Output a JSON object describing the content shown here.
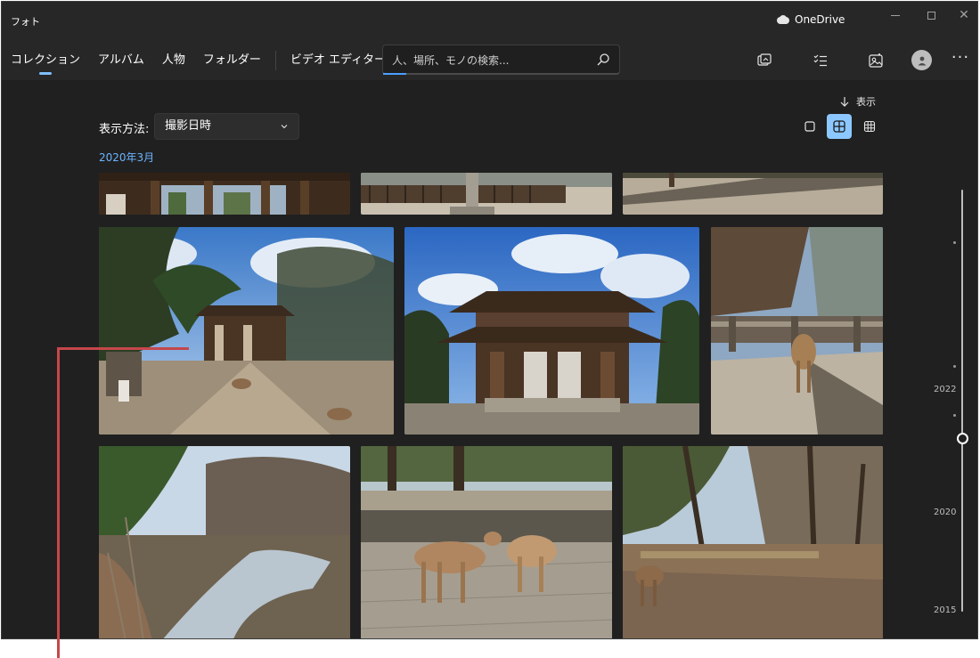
{
  "app": {
    "title": "フォト"
  },
  "onedrive": {
    "label": "OneDrive"
  },
  "nav": {
    "tabs": [
      {
        "label": "コレクション",
        "active": true
      },
      {
        "label": "アルバム"
      },
      {
        "label": "人物"
      },
      {
        "label": "フォルダー"
      },
      {
        "label": "ビデオ エディター"
      }
    ]
  },
  "search": {
    "placeholder": "人、場所、モノの検索..."
  },
  "toolbar": {
    "icons": [
      "import-icon",
      "select-icon",
      "edit-image-icon",
      "account-avatar",
      "more-icon"
    ],
    "sort_label": "表示"
  },
  "view": {
    "label": "表示方法:",
    "selected": "撮影日時",
    "size_options": [
      "large",
      "medium",
      "small"
    ],
    "active_size": "medium"
  },
  "collection": {
    "date_group": "2020年3月",
    "photos": [
      {
        "desc": "temple gate wooden detail"
      },
      {
        "desc": "stone lantern and wooden fence"
      },
      {
        "desc": "gravel path and stones"
      },
      {
        "desc": "temple gate with deer in courtyard"
      },
      {
        "desc": "great wooden temple gate under blue sky"
      },
      {
        "desc": "deer on wooden bridge"
      },
      {
        "desc": "stream through woods"
      },
      {
        "desc": "two deer touching noses"
      },
      {
        "desc": "deer in park with trees"
      }
    ]
  },
  "timeline": {
    "years": [
      "2022",
      "2020",
      "2015"
    ],
    "accent": "#6cb4ff"
  },
  "colors": {
    "window_bg": "#272727",
    "content_bg": "#202020",
    "accent": "#8cc8ff",
    "annotation": "#c6474b"
  }
}
